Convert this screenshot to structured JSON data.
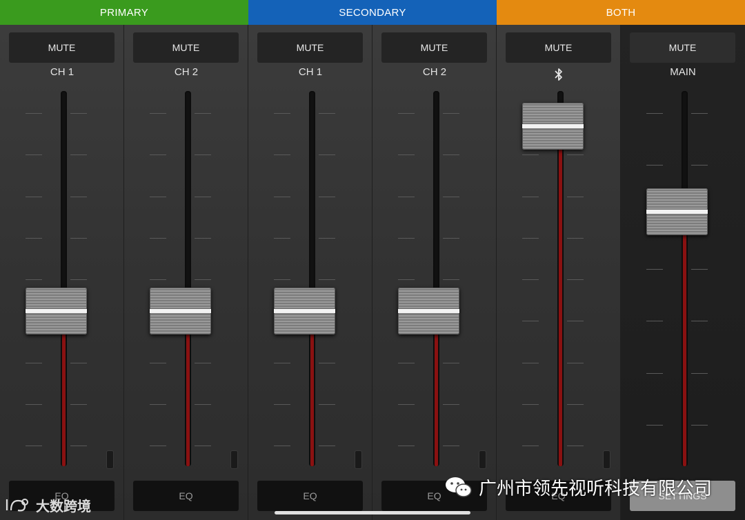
{
  "groups": [
    {
      "label": "PRIMARY",
      "color": "#3a9b1e"
    },
    {
      "label": "SECONDARY",
      "color": "#1462b8"
    },
    {
      "label": "BOTH",
      "color": "#e48a10"
    }
  ],
  "channels": [
    {
      "mute_label": "MUTE",
      "name": "CH 1",
      "bottom_label": "EQ",
      "fader_level": 0.4
    },
    {
      "mute_label": "MUTE",
      "name": "CH 2",
      "bottom_label": "EQ",
      "fader_level": 0.4
    },
    {
      "mute_label": "MUTE",
      "name": "CH 1",
      "bottom_label": "EQ",
      "fader_level": 0.4
    },
    {
      "mute_label": "MUTE",
      "name": "CH 2",
      "bottom_label": "EQ",
      "fader_level": 0.4
    },
    {
      "mute_label": "MUTE",
      "icon": "bluetooth-icon",
      "bottom_label": "EQ",
      "fader_level": 0.96
    },
    {
      "mute_label": "MUTE",
      "name": "MAIN",
      "bottom_label": "SETTINGS",
      "fader_level": 0.7
    }
  ],
  "watermark_left": "大数跨境",
  "watermark_right": "广州市领先视听科技有限公司",
  "colors": {
    "fader_fill": "#8a1111",
    "knob_line": "#f2f2f2"
  }
}
